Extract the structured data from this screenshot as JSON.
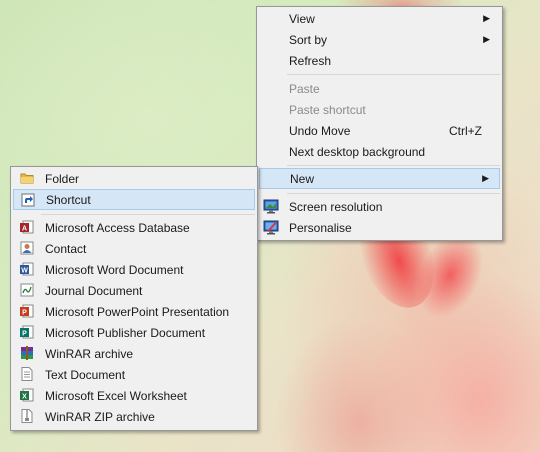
{
  "context_menu": {
    "items": [
      {
        "label": "View",
        "arrow": "▶"
      },
      {
        "label": "Sort by",
        "arrow": "▶"
      },
      {
        "label": "Refresh"
      },
      {
        "label": "Paste"
      },
      {
        "label": "Paste shortcut"
      },
      {
        "label": "Undo Move",
        "shortcut": "Ctrl+Z"
      },
      {
        "label": "Next desktop background"
      },
      {
        "label": "New",
        "arrow": "▶"
      },
      {
        "label": "Screen resolution",
        "icon": "screen-resolution-icon"
      },
      {
        "label": "Personalise",
        "icon": "personalise-icon"
      }
    ]
  },
  "new_submenu": {
    "items": [
      {
        "label": "Folder",
        "icon": "folder-icon"
      },
      {
        "label": "Shortcut",
        "icon": "shortcut-icon"
      },
      {
        "label": "Microsoft Access Database",
        "icon": "access-icon"
      },
      {
        "label": "Contact",
        "icon": "contact-icon"
      },
      {
        "label": "Microsoft Word Document",
        "icon": "word-icon"
      },
      {
        "label": "Journal Document",
        "icon": "journal-icon"
      },
      {
        "label": "Microsoft PowerPoint Presentation",
        "icon": "powerpoint-icon"
      },
      {
        "label": "Microsoft Publisher Document",
        "icon": "publisher-icon"
      },
      {
        "label": "WinRAR archive",
        "icon": "winrar-icon"
      },
      {
        "label": "Text Document",
        "icon": "text-document-icon"
      },
      {
        "label": "Microsoft Excel Worksheet",
        "icon": "excel-icon"
      },
      {
        "label": "WinRAR ZIP archive",
        "icon": "winrar-zip-icon"
      }
    ]
  },
  "colors": {
    "menu_bg": "#f0f0f0",
    "highlight_bg": "#d5e6f7",
    "highlight_border": "#a8cbeb",
    "disabled_text": "#8a8a8a"
  }
}
